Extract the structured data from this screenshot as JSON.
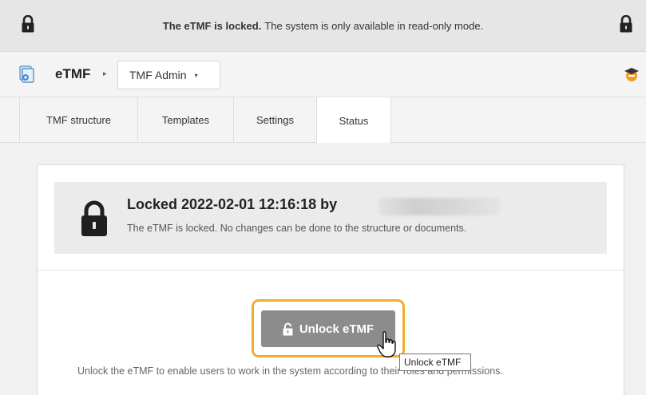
{
  "banner": {
    "strong": "The eTMF is locked.",
    "text": "The system is only available in read-only mode.",
    "left_icon": "lock-icon",
    "right_icon": "lock-icon"
  },
  "header": {
    "app_icon": "etmf-app-icon",
    "app_title": "eTMF",
    "crumb_separator": "▸",
    "module_select": {
      "value": "TMF Admin",
      "caret": "▾"
    },
    "user_icon": "graduation-cap-icon"
  },
  "tabs": [
    {
      "label": "TMF structure",
      "active": false
    },
    {
      "label": "Templates",
      "active": false
    },
    {
      "label": "Settings",
      "active": false
    },
    {
      "label": "Status",
      "active": true
    }
  ],
  "status": {
    "locked_title": "Locked 2022-02-01 12:16:18 by",
    "locked_desc": "The eTMF is locked. No changes can be done to the structure or documents.",
    "unlock_button": "Unlock eTMF",
    "tooltip": "Unlock eTMF",
    "help_text": "Unlock the eTMF to enable users to work in the system according to their roles and permissions."
  },
  "colors": {
    "accent_focus": "#f2ad2e",
    "button_bg": "#8c8c8c",
    "banner_bg": "#e6e6e6"
  }
}
